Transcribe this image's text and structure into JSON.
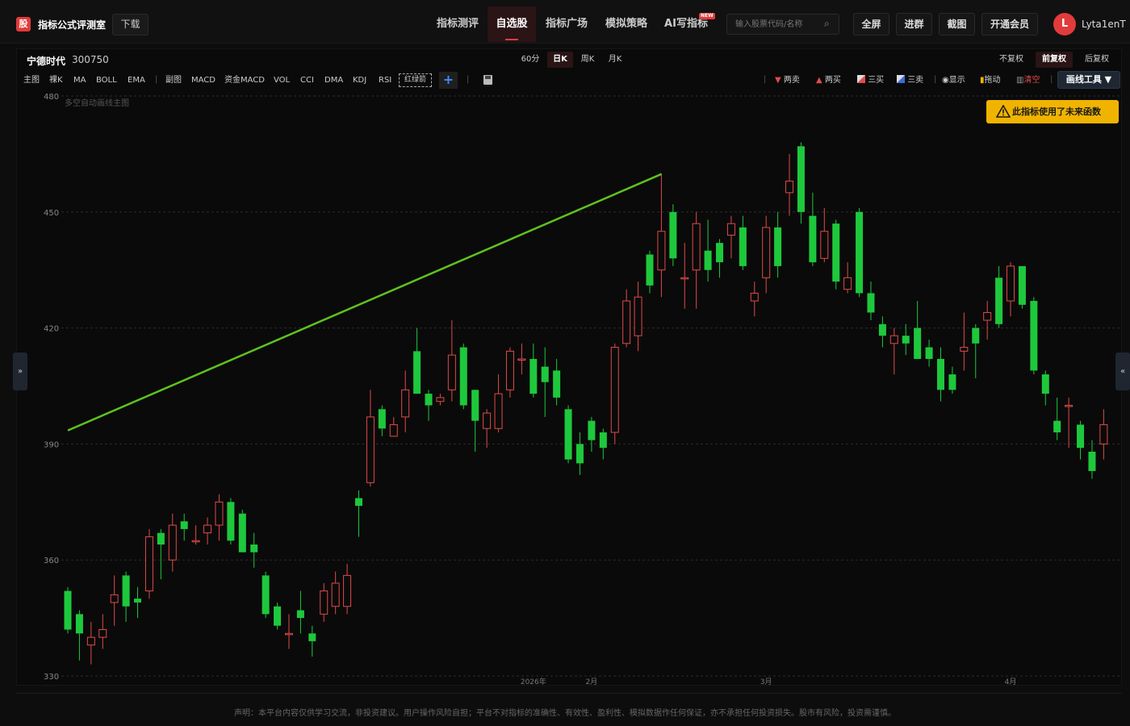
{
  "app": {
    "logo_char": "股",
    "title": "指标公式评测室",
    "download": "下载"
  },
  "nav": [
    {
      "label": "指标测评"
    },
    {
      "label": "自选股"
    },
    {
      "label": "指标广场"
    },
    {
      "label": "模拟策略"
    },
    {
      "label": "AI写指标"
    }
  ],
  "nav_badge": "NEW",
  "search": {
    "placeholder": "输入股票代码/名称"
  },
  "top_buttons": [
    "全屏",
    "进群",
    "截图",
    "开通会员"
  ],
  "user": {
    "avatar_letter": "L",
    "name": "Lyta1enT"
  },
  "stock": {
    "name": "宁德时代",
    "code": "300750"
  },
  "periods": [
    "60分",
    "日K",
    "周K",
    "月K"
  ],
  "active_period": "日K",
  "adjust": [
    "不复权",
    "前复权",
    "后复权"
  ],
  "active_adjust": "前复权",
  "indicators_main": [
    "主图",
    "裸K",
    "MA",
    "BOLL",
    "EMA"
  ],
  "indicators_sub": [
    "副图",
    "MACD",
    "资金MACD",
    "VOL",
    "CCI",
    "DMA",
    "KDJ",
    "RSI"
  ],
  "indicator_selected": "红绿箭",
  "draw_tools": [
    "两卖",
    "两买",
    "三买",
    "三卖",
    "显示",
    "拖动",
    "清空"
  ],
  "draw_menu": "画线工具 ▼",
  "chart_subtitle": "多空自动画线主图",
  "warning": "此指标使用了未来函数",
  "disclaimer": "声明：本平台内容仅供学习交流，非投资建议。用户操作风险自担；平台不对指标的准确性、有效性、盈利性、模拟数据作任何保证，亦不承担任何投资损失。股市有风险，投资需谨慎。",
  "colors": {
    "up": "#e04a4a",
    "down": "#1ec83c",
    "trend_line": "#5ec21e",
    "accent": "#e23b3b",
    "warning": "#f0b400"
  },
  "chart_data": {
    "type": "candlestick",
    "ylim": [
      330,
      480
    ],
    "yticks": [
      330,
      360,
      390,
      420,
      450,
      480
    ],
    "xticks": [
      {
        "index": 40,
        "label": "2026年"
      },
      {
        "index": 45,
        "label": "2月"
      },
      {
        "index": 60,
        "label": "3月"
      },
      {
        "index": 81,
        "label": "4月"
      }
    ],
    "candles": [
      {
        "o": 352,
        "c": 342,
        "h": 353,
        "l": 341
      },
      {
        "o": 346,
        "c": 341,
        "h": 347,
        "l": 334
      },
      {
        "o": 338,
        "c": 340,
        "h": 344,
        "l": 333
      },
      {
        "o": 340,
        "c": 342,
        "h": 346,
        "l": 337
      },
      {
        "o": 349,
        "c": 351,
        "h": 356,
        "l": 343
      },
      {
        "o": 356,
        "c": 348,
        "h": 357,
        "l": 344
      },
      {
        "o": 350,
        "c": 349,
        "h": 353,
        "l": 345
      },
      {
        "o": 352,
        "c": 366,
        "h": 368,
        "l": 350
      },
      {
        "o": 367,
        "c": 364,
        "h": 368,
        "l": 355
      },
      {
        "o": 360,
        "c": 369,
        "h": 372,
        "l": 357
      },
      {
        "o": 370,
        "c": 368,
        "h": 372,
        "l": 365
      },
      {
        "o": 365,
        "c": 365,
        "h": 369,
        "l": 364
      },
      {
        "o": 367,
        "c": 369,
        "h": 371,
        "l": 364
      },
      {
        "o": 369,
        "c": 375,
        "h": 377,
        "l": 365
      },
      {
        "o": 375,
        "c": 365,
        "h": 376,
        "l": 364
      },
      {
        "o": 372,
        "c": 362,
        "h": 373,
        "l": 362
      },
      {
        "o": 364,
        "c": 362,
        "h": 367,
        "l": 358
      },
      {
        "o": 356,
        "c": 346,
        "h": 357,
        "l": 345
      },
      {
        "o": 348,
        "c": 343,
        "h": 349,
        "l": 342
      },
      {
        "o": 341,
        "c": 341,
        "h": 346,
        "l": 337
      },
      {
        "o": 347,
        "c": 345,
        "h": 352,
        "l": 341
      },
      {
        "o": 341,
        "c": 339,
        "h": 343,
        "l": 335
      },
      {
        "o": 346,
        "c": 352,
        "h": 354,
        "l": 344
      },
      {
        "o": 348,
        "c": 354,
        "h": 357,
        "l": 346
      },
      {
        "o": 348,
        "c": 356,
        "h": 359,
        "l": 346
      },
      {
        "o": 376,
        "c": 374,
        "h": 378,
        "l": 366
      },
      {
        "o": 380,
        "c": 397,
        "h": 404,
        "l": 379
      },
      {
        "o": 399,
        "c": 394,
        "h": 400,
        "l": 392
      },
      {
        "o": 392,
        "c": 395,
        "h": 397,
        "l": 392
      },
      {
        "o": 397,
        "c": 404,
        "h": 409,
        "l": 393
      },
      {
        "o": 414,
        "c": 403,
        "h": 420,
        "l": 403
      },
      {
        "o": 403,
        "c": 400,
        "h": 404,
        "l": 396
      },
      {
        "o": 401,
        "c": 402,
        "h": 403,
        "l": 400
      },
      {
        "o": 404,
        "c": 413,
        "h": 422,
        "l": 401
      },
      {
        "o": 415,
        "c": 400,
        "h": 416,
        "l": 399
      },
      {
        "o": 404,
        "c": 396,
        "h": 404,
        "l": 388
      },
      {
        "o": 394,
        "c": 398,
        "h": 399,
        "l": 389
      },
      {
        "o": 394,
        "c": 403,
        "h": 408,
        "l": 393
      },
      {
        "o": 404,
        "c": 414,
        "h": 415,
        "l": 402
      },
      {
        "o": 412,
        "c": 412,
        "h": 416,
        "l": 408
      },
      {
        "o": 412,
        "c": 403,
        "h": 416,
        "l": 402
      },
      {
        "o": 410,
        "c": 406,
        "h": 415,
        "l": 397
      },
      {
        "o": 409,
        "c": 402,
        "h": 412,
        "l": 400
      },
      {
        "o": 399,
        "c": 386,
        "h": 400,
        "l": 385
      },
      {
        "o": 390,
        "c": 385,
        "h": 393,
        "l": 382
      },
      {
        "o": 396,
        "c": 391,
        "h": 397,
        "l": 388
      },
      {
        "o": 393,
        "c": 389,
        "h": 394,
        "l": 386
      },
      {
        "o": 393,
        "c": 415,
        "h": 416,
        "l": 390
      },
      {
        "o": 416,
        "c": 427,
        "h": 430,
        "l": 415
      },
      {
        "o": 418,
        "c": 428,
        "h": 432,
        "l": 414
      },
      {
        "o": 439,
        "c": 431,
        "h": 440,
        "l": 429
      },
      {
        "o": 435,
        "c": 445,
        "h": 460,
        "l": 428
      },
      {
        "o": 450,
        "c": 438,
        "h": 452,
        "l": 436
      },
      {
        "o": 433,
        "c": 433,
        "h": 442,
        "l": 425
      },
      {
        "o": 435,
        "c": 447,
        "h": 450,
        "l": 425
      },
      {
        "o": 440,
        "c": 435,
        "h": 448,
        "l": 432
      },
      {
        "o": 442,
        "c": 437,
        "h": 443,
        "l": 433
      },
      {
        "o": 444,
        "c": 447,
        "h": 449,
        "l": 438
      },
      {
        "o": 446,
        "c": 436,
        "h": 449,
        "l": 435
      },
      {
        "o": 427,
        "c": 429,
        "h": 432,
        "l": 423
      },
      {
        "o": 433,
        "c": 446,
        "h": 449,
        "l": 429
      },
      {
        "o": 446,
        "c": 436,
        "h": 450,
        "l": 433
      },
      {
        "o": 455,
        "c": 458,
        "h": 465,
        "l": 449
      },
      {
        "o": 467,
        "c": 450,
        "h": 468,
        "l": 447
      },
      {
        "o": 449,
        "c": 437,
        "h": 455,
        "l": 436
      },
      {
        "o": 438,
        "c": 445,
        "h": 451,
        "l": 437
      },
      {
        "o": 447,
        "c": 432,
        "h": 448,
        "l": 430
      },
      {
        "o": 430,
        "c": 433,
        "h": 437,
        "l": 429
      },
      {
        "o": 450,
        "c": 429,
        "h": 451,
        "l": 428
      },
      {
        "o": 429,
        "c": 424,
        "h": 432,
        "l": 422
      },
      {
        "o": 421,
        "c": 418,
        "h": 423,
        "l": 415
      },
      {
        "o": 416,
        "c": 418,
        "h": 420,
        "l": 408
      },
      {
        "o": 418,
        "c": 416,
        "h": 421,
        "l": 413
      },
      {
        "o": 420,
        "c": 412,
        "h": 427,
        "l": 412
      },
      {
        "o": 415,
        "c": 412,
        "h": 417,
        "l": 410
      },
      {
        "o": 412,
        "c": 404,
        "h": 415,
        "l": 401
      },
      {
        "o": 408,
        "c": 404,
        "h": 410,
        "l": 403
      },
      {
        "o": 414,
        "c": 415,
        "h": 424,
        "l": 409
      },
      {
        "o": 420,
        "c": 416,
        "h": 421,
        "l": 407
      },
      {
        "o": 422,
        "c": 424,
        "h": 427,
        "l": 417
      },
      {
        "o": 433,
        "c": 421,
        "h": 436,
        "l": 420
      },
      {
        "o": 427,
        "c": 436,
        "h": 437,
        "l": 423
      },
      {
        "o": 436,
        "c": 426,
        "h": 436,
        "l": 425
      },
      {
        "o": 427,
        "c": 409,
        "h": 428,
        "l": 408
      },
      {
        "o": 408,
        "c": 403,
        "h": 409,
        "l": 400
      },
      {
        "o": 396,
        "c": 393,
        "h": 402,
        "l": 391
      },
      {
        "o": 400,
        "c": 400,
        "h": 402,
        "l": 389
      },
      {
        "o": 395,
        "c": 389,
        "h": 396,
        "l": 386
      },
      {
        "o": 388,
        "c": 383,
        "h": 391,
        "l": 381
      },
      {
        "o": 390,
        "c": 395,
        "h": 399,
        "l": 386
      }
    ],
    "trend_line": [
      {
        "index": 0,
        "value": 393.5
      },
      {
        "index": 51,
        "value": 459.8
      }
    ]
  }
}
